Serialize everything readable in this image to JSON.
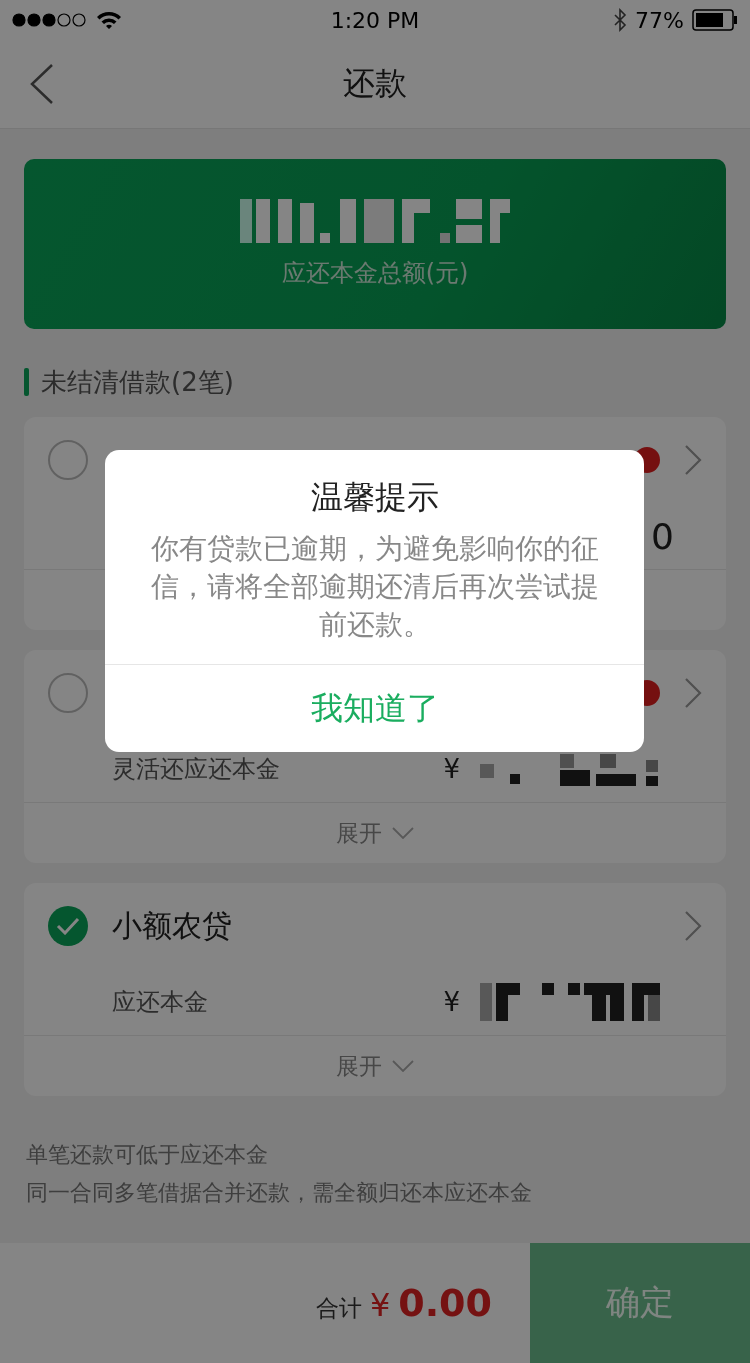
{
  "status_bar": {
    "time": "1:20 PM",
    "battery": "77%"
  },
  "nav": {
    "title": "还款"
  },
  "summary": {
    "caption": "应还本金总额(元)"
  },
  "section": {
    "title": "未结清借款(2笔)"
  },
  "loans": [
    {
      "selected": false,
      "overdue": true,
      "amount_tail": "0"
    },
    {
      "selected": false,
      "overdue": true,
      "amount_label": "灵活还应还本金",
      "currency": "¥",
      "expand": "展开"
    },
    {
      "selected": true,
      "overdue": false,
      "title": "小额农贷",
      "amount_label": "应还本金",
      "currency": "¥",
      "expand": "展开"
    }
  ],
  "notes": [
    "单笔还款可低于应还本金",
    "同一合同多笔借据合并还款，需全额归还本应还本金"
  ],
  "footer": {
    "total_label": "合计",
    "currency": "¥",
    "total": "0.00",
    "confirm": "确定",
    "confirm_disabled": true
  },
  "dialog": {
    "title": "温馨提示",
    "message": "你有贷款已逾期，为避免影响你的征信，请将全部逾期还清后再次尝试提前还款。",
    "button": "我知道了"
  }
}
